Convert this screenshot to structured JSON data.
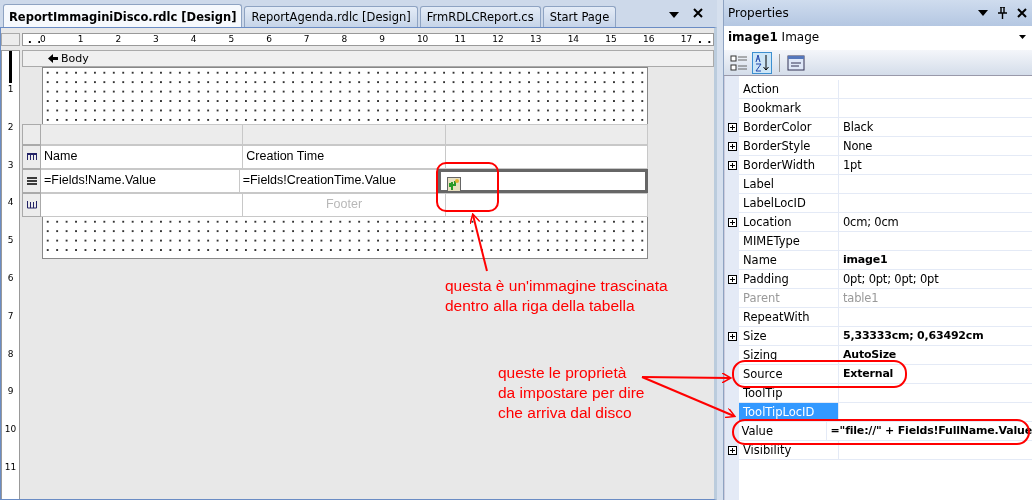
{
  "document_tabs": [
    {
      "label": "ReportImmaginiDisco.rdlc [Design]",
      "selected": true
    },
    {
      "label": "ReportAgenda.rdlc [Design]",
      "selected": false
    },
    {
      "label": "FrmRDLCReport.cs",
      "selected": false
    },
    {
      "label": "Start Page",
      "selected": false
    }
  ],
  "ruler": {
    "horizontal": [
      "0",
      "1",
      "2",
      "3",
      "4",
      "5",
      "6",
      "7",
      "8",
      "9",
      "10",
      "11",
      "12",
      "13",
      "14",
      "15",
      "16",
      "17"
    ],
    "vertical": [
      "1",
      "2",
      "3",
      "4",
      "5",
      "6",
      "7",
      "8",
      "9",
      "10",
      "11"
    ]
  },
  "body_band": {
    "label": "Body"
  },
  "table": {
    "header": [
      "Name",
      "Creation Time"
    ],
    "detail": [
      "=Fields!Name.Value",
      "=Fields!CreationTime.Value"
    ],
    "footer": {
      "label": "Footer"
    }
  },
  "properties": {
    "title": "Properties",
    "object_name": "image1",
    "object_type": "Image",
    "rows": [
      {
        "name": "Action",
        "expandable": false,
        "disabled": false,
        "selected": false
      },
      {
        "name": "Bookmark",
        "expandable": false,
        "disabled": false,
        "selected": false
      },
      {
        "name": "BorderColor",
        "value": "Black",
        "expandable": true,
        "bold": false,
        "disabled": false,
        "selected": false
      },
      {
        "name": "BorderStyle",
        "value": "None",
        "expandable": true,
        "bold": false,
        "disabled": false,
        "selected": false
      },
      {
        "name": "BorderWidth",
        "value": "1pt",
        "expandable": true,
        "bold": false,
        "disabled": false,
        "selected": false
      },
      {
        "name": "Label",
        "expandable": false,
        "disabled": false,
        "selected": false
      },
      {
        "name": "LabelLocID",
        "expandable": false,
        "disabled": false,
        "selected": false
      },
      {
        "name": "Location",
        "value": "0cm; 0cm",
        "expandable": true,
        "bold": false,
        "disabled": false,
        "selected": false
      },
      {
        "name": "MIMEType",
        "expandable": false,
        "disabled": false,
        "selected": false
      },
      {
        "name": "Name",
        "value": "image1",
        "expandable": false,
        "bold": true,
        "disabled": false,
        "selected": false
      },
      {
        "name": "Padding",
        "value": "0pt; 0pt; 0pt; 0pt",
        "expandable": true,
        "bold": false,
        "disabled": false,
        "selected": false
      },
      {
        "name": "Parent",
        "value": "table1",
        "expandable": false,
        "bold": false,
        "disabled": true,
        "selected": false
      },
      {
        "name": "RepeatWith",
        "expandable": false,
        "disabled": false,
        "selected": false
      },
      {
        "name": "Size",
        "value": "5,33333cm; 0,63492cm",
        "expandable": true,
        "bold": true,
        "disabled": false,
        "selected": false
      },
      {
        "name": "Sizing",
        "value": "AutoSize",
        "expandable": false,
        "bold": true,
        "disabled": false,
        "selected": false
      },
      {
        "name": "Source",
        "value": "External",
        "expandable": false,
        "bold": true,
        "disabled": false,
        "selected": false
      },
      {
        "name": "ToolTip",
        "expandable": false,
        "disabled": false,
        "selected": false
      },
      {
        "name": "ToolTipLocID",
        "expandable": false,
        "disabled": false,
        "selected": true
      },
      {
        "name": "Value",
        "value": "=\"file://\" + Fields!FullName.Value",
        "expandable": false,
        "bold": true,
        "disabled": false,
        "selected": false
      },
      {
        "name": "Visibility",
        "expandable": true,
        "disabled": false,
        "selected": false
      }
    ]
  },
  "annotations": [
    {
      "text": "questa è un'immagine trascinata dentro alla riga della tabella"
    },
    {
      "text": "queste le proprietà da impostare per dire che arriva dal disco"
    }
  ]
}
